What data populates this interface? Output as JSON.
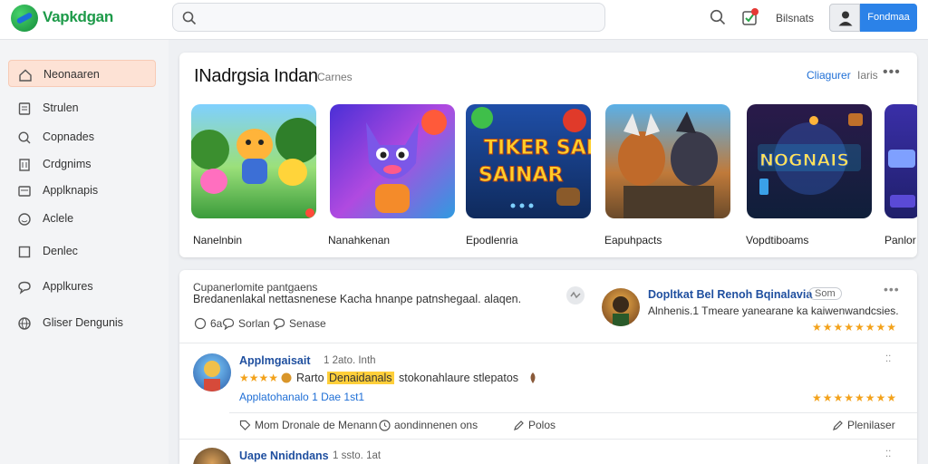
{
  "header": {
    "app_title": "Vapkdgan",
    "search": {
      "value": "",
      "placeholder": ""
    },
    "link": "Bilsnats",
    "primary_button": "Fondmaa"
  },
  "sidebar": {
    "items": [
      {
        "label": "Neonaaren",
        "icon": "home-icon",
        "active": true
      },
      {
        "label": "Strulen",
        "icon": "book-icon"
      },
      {
        "label": "Copnades",
        "icon": "search-icon"
      },
      {
        "label": "Crdgnims",
        "icon": "building-icon"
      },
      {
        "label": "Applknapis",
        "icon": "card-icon"
      },
      {
        "label": "Aclele",
        "icon": "smile-icon"
      },
      {
        "label": "Denlec",
        "icon": "square-icon"
      },
      {
        "label": "Applkures",
        "icon": "chat-icon"
      },
      {
        "label": "Gliser Dengunis",
        "icon": "globe-icon"
      }
    ]
  },
  "featured": {
    "title": "INadrgsia Indan",
    "subtitle": "Carnes",
    "link": "Cliagurer",
    "more": "Iaris",
    "games": [
      {
        "label": "Nanelnbin",
        "art_text": ""
      },
      {
        "label": "Nanahkenan",
        "art_text": ""
      },
      {
        "label": "Epodlenria",
        "art_text": "TIKER SAINAR"
      },
      {
        "label": "Eapuhpacts",
        "art_text": ""
      },
      {
        "label": "Vopdtiboams",
        "art_text": "NOGNAIS"
      },
      {
        "label": "Panlor",
        "art_text": ""
      }
    ]
  },
  "feed": {
    "post1": {
      "heading": "Cupanerlomite pantgaens",
      "body": "Bredanenlakal nettasnenese Kacha hnanpe patnshegaal. alaqen.",
      "count": "6a",
      "action1": "Sorlan",
      "action2": "Senase"
    },
    "side_review": {
      "title": "Dopltkat Bel Renoh Bqinalavia",
      "badge": "Som",
      "text": "Alnhenis.1 Tmeare yanearane ka kaiwenwandcsies.",
      "rating": 5
    },
    "review1": {
      "name": "Applmgaisait",
      "meta": "1 2ato. Inth",
      "stars_text": "★★★★",
      "rating_label": "Rarto",
      "highlight": "Denaidanals",
      "body": "stokonahlaure stlepatos",
      "sublink": "Applatohanalo 1 Dae 1st1",
      "rating": 5,
      "actions": [
        "Mom Dronale de Menann",
        "aondinnenen ons",
        "Polos"
      ],
      "reply": "Plenilaser"
    },
    "review2": {
      "name": "Uape Nnidndans",
      "meta": "1 ssto. 1at"
    }
  },
  "colors": {
    "brand": "#1d9a49",
    "accent": "#2b82e8",
    "active_nav": "#fde2d5",
    "link": "#1f6fd6",
    "star": "#f3a21b"
  }
}
